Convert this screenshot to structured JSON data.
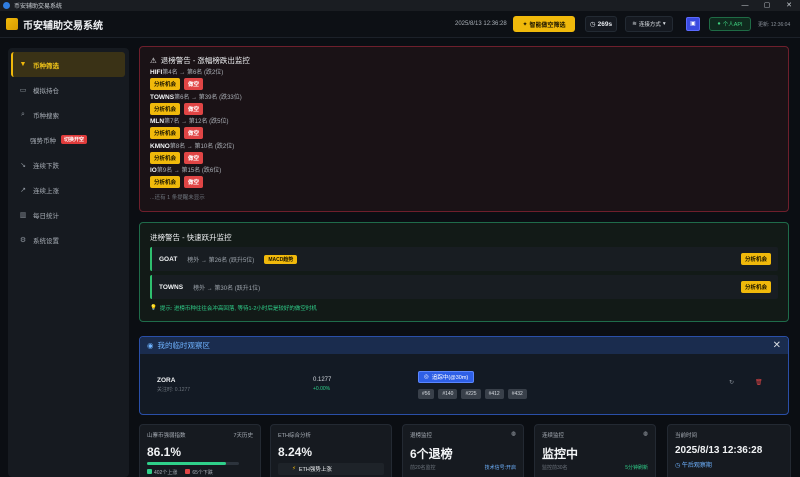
{
  "window": {
    "title": "币安辅助交易系统",
    "min": "—",
    "max": "▢",
    "close": "✕"
  },
  "header": {
    "title": "币安辅助交易系统",
    "datetime": "2025/8/13 12:36:28",
    "smart_button": "智能做空筛选",
    "timer": "269s",
    "connection": "连接方式",
    "api_button": "个人API",
    "update": "更新: 12:36:04"
  },
  "sidebar": {
    "items": [
      {
        "label": "币种筛选",
        "icon": "filter-icon"
      },
      {
        "label": "模拟持仓",
        "icon": "wallet-icon"
      },
      {
        "label": "币种搜索",
        "icon": "search-icon"
      },
      {
        "label": "强势币种",
        "badge": "切换开空"
      },
      {
        "label": "连续下跌",
        "icon": "trend-down-icon"
      },
      {
        "label": "连续上涨",
        "icon": "trend-up-icon"
      },
      {
        "label": "每日统计",
        "icon": "bar-chart-icon"
      },
      {
        "label": "系统设置",
        "icon": "gear-icon"
      }
    ]
  },
  "drop_warning": {
    "title": "退榜警告 - 涨幅榜跌出监控",
    "items": [
      {
        "symbol": "HIFI",
        "detail": "第4名 → 第6名 (跌2位)"
      },
      {
        "symbol": "TOWNS",
        "detail": "第6名 → 第39名 (跌33位)"
      },
      {
        "symbol": "MLN",
        "detail": "第7名 → 第12名 (跌5位)"
      },
      {
        "symbol": "KMNO",
        "detail": "第8名 → 第10名 (跌2位)"
      },
      {
        "symbol": "IO",
        "detail": "第9名 → 第15名 (跌6位)"
      }
    ],
    "analyze_label": "分析机会",
    "short_label": "做空",
    "more": "...还有 1 条提醒未显示"
  },
  "rise_warning": {
    "title": "进榜警告 - 快速跃升监控",
    "items": [
      {
        "symbol": "GOAT",
        "detail": "榜外 → 第26名 (跃升5位)",
        "tag": "MACD趋势"
      },
      {
        "symbol": "TOWNS",
        "detail": "榜外 → 第30名 (跃升1位)",
        "tag": ""
      }
    ],
    "analyze_label": "分析机会",
    "hint": "提示: 进榜币种往往会冲高回落, 等待1-2小时后是较好的做空时机"
  },
  "watch": {
    "title": "我的临时观察区",
    "symbol": "ZORA",
    "since": "关注时: 0.1277",
    "price": "0.1277",
    "change": "+0.00%",
    "tracking": "追踪中(@30m)",
    "tags": [
      "#56",
      "#140",
      "#225",
      "#412",
      "#432"
    ]
  },
  "cards": {
    "c1": {
      "title": "山寨币强弱指数",
      "extra": "7天历史",
      "value": "86.1%",
      "progress": 0.861,
      "up": "402个上涨",
      "down": "65个下跌"
    },
    "c2": {
      "title": "ETH综合分析",
      "value": "8.24%",
      "box": "ETH强势上涨"
    },
    "c3": {
      "title": "退榜监控",
      "value": "6个退榜",
      "sub_left": "前20名监控",
      "sub_right": "技术信号:开启"
    },
    "c4": {
      "title": "连续监控",
      "value": "监控中",
      "sub_left": "监控前30名",
      "sub_right": "5分钟刷新"
    },
    "c5": {
      "title": "当前时间",
      "value": "2025/8/13 12:36:28",
      "sub": "午后观察期"
    }
  }
}
